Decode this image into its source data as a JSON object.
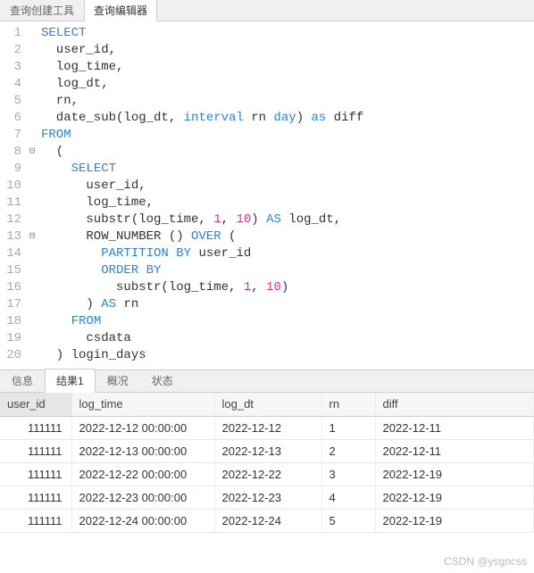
{
  "top_tabs": {
    "tab1": "查询创建工具",
    "tab2": "查询编辑器"
  },
  "code": {
    "lines": [
      {
        "n": "1",
        "fold": "",
        "tokens": [
          {
            "t": "SELECT",
            "c": "kw"
          }
        ]
      },
      {
        "n": "2",
        "fold": "",
        "tokens": [
          {
            "t": "  user_id,",
            "c": ""
          }
        ]
      },
      {
        "n": "3",
        "fold": "",
        "tokens": [
          {
            "t": "  log_time,",
            "c": ""
          }
        ]
      },
      {
        "n": "4",
        "fold": "",
        "tokens": [
          {
            "t": "  log_dt,",
            "c": ""
          }
        ]
      },
      {
        "n": "5",
        "fold": "",
        "tokens": [
          {
            "t": "  rn,",
            "c": ""
          }
        ]
      },
      {
        "n": "6",
        "fold": "",
        "tokens": [
          {
            "t": "  date_sub(log_dt, ",
            "c": ""
          },
          {
            "t": "interval",
            "c": "kw"
          },
          {
            "t": " rn ",
            "c": ""
          },
          {
            "t": "day",
            "c": "kw"
          },
          {
            "t": ") ",
            "c": ""
          },
          {
            "t": "as",
            "c": "kw"
          },
          {
            "t": " diff",
            "c": ""
          }
        ]
      },
      {
        "n": "7",
        "fold": "",
        "tokens": [
          {
            "t": "FROM",
            "c": "kw"
          }
        ]
      },
      {
        "n": "8",
        "fold": "⊟",
        "tokens": [
          {
            "t": "  (",
            "c": ""
          }
        ]
      },
      {
        "n": "9",
        "fold": "",
        "tokens": [
          {
            "t": "    ",
            "c": ""
          },
          {
            "t": "SELECT",
            "c": "kw"
          }
        ]
      },
      {
        "n": "10",
        "fold": "",
        "tokens": [
          {
            "t": "      user_id,",
            "c": ""
          }
        ]
      },
      {
        "n": "11",
        "fold": "",
        "tokens": [
          {
            "t": "      log_time,",
            "c": ""
          }
        ]
      },
      {
        "n": "12",
        "fold": "",
        "tokens": [
          {
            "t": "      substr(log_time, ",
            "c": ""
          },
          {
            "t": "1",
            "c": "num"
          },
          {
            "t": ", ",
            "c": ""
          },
          {
            "t": "10",
            "c": "num"
          },
          {
            "t": ") ",
            "c": ""
          },
          {
            "t": "AS",
            "c": "kw"
          },
          {
            "t": " log_dt,",
            "c": ""
          }
        ]
      },
      {
        "n": "13",
        "fold": "⊟",
        "tokens": [
          {
            "t": "      ROW_NUMBER () ",
            "c": ""
          },
          {
            "t": "OVER",
            "c": "kw"
          },
          {
            "t": " (",
            "c": ""
          }
        ]
      },
      {
        "n": "14",
        "fold": "",
        "tokens": [
          {
            "t": "        ",
            "c": ""
          },
          {
            "t": "PARTITION BY",
            "c": "kw"
          },
          {
            "t": " user_id",
            "c": ""
          }
        ]
      },
      {
        "n": "15",
        "fold": "",
        "tokens": [
          {
            "t": "        ",
            "c": ""
          },
          {
            "t": "ORDER BY",
            "c": "kw"
          }
        ]
      },
      {
        "n": "16",
        "fold": "",
        "tokens": [
          {
            "t": "          substr(log_time, ",
            "c": ""
          },
          {
            "t": "1",
            "c": "num"
          },
          {
            "t": ", ",
            "c": ""
          },
          {
            "t": "10",
            "c": "num"
          },
          {
            "t": ")",
            "c": ""
          }
        ]
      },
      {
        "n": "17",
        "fold": "",
        "tokens": [
          {
            "t": "      ) ",
            "c": ""
          },
          {
            "t": "AS",
            "c": "kw"
          },
          {
            "t": " rn",
            "c": ""
          }
        ]
      },
      {
        "n": "18",
        "fold": "",
        "tokens": [
          {
            "t": "    ",
            "c": ""
          },
          {
            "t": "FROM",
            "c": "kw"
          }
        ]
      },
      {
        "n": "19",
        "fold": "",
        "tokens": [
          {
            "t": "      csdata",
            "c": ""
          }
        ]
      },
      {
        "n": "20",
        "fold": "",
        "tokens": [
          {
            "t": "  ) login_days",
            "c": ""
          }
        ]
      }
    ]
  },
  "bottom_tabs": {
    "tab1": "信息",
    "tab2": "结果1",
    "tab3": "概况",
    "tab4": "状态"
  },
  "result": {
    "columns": [
      "user_id",
      "log_time",
      "log_dt",
      "rn",
      "diff"
    ],
    "rows": [
      [
        "111111",
        "2022-12-12 00:00:00",
        "2022-12-12",
        "1",
        "2022-12-11"
      ],
      [
        "111111",
        "2022-12-13 00:00:00",
        "2022-12-13",
        "2",
        "2022-12-11"
      ],
      [
        "111111",
        "2022-12-22 00:00:00",
        "2022-12-22",
        "3",
        "2022-12-19"
      ],
      [
        "111111",
        "2022-12-23 00:00:00",
        "2022-12-23",
        "4",
        "2022-12-19"
      ],
      [
        "111111",
        "2022-12-24 00:00:00",
        "2022-12-24",
        "5",
        "2022-12-19"
      ]
    ]
  },
  "watermark": "CSDN @ysgncss"
}
